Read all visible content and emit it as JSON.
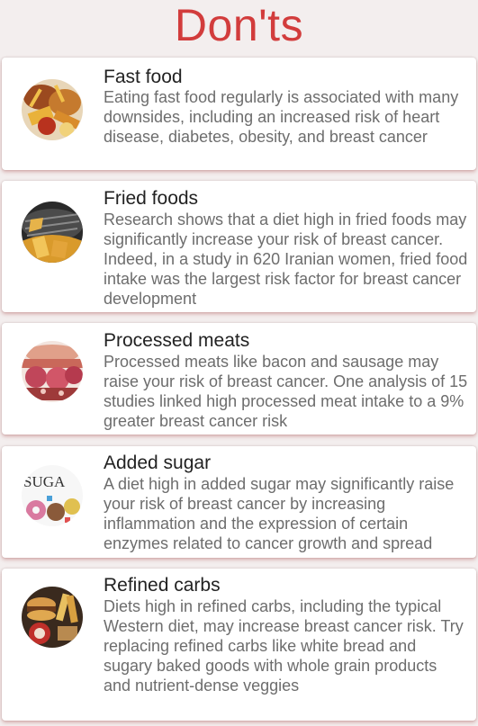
{
  "page": {
    "title": "Don'ts"
  },
  "items": [
    {
      "title": "Fast food",
      "description": "Eating fast food regularly is associated with many downsides, including an increased risk of heart disease, diabetes, obesity, and breast cancer",
      "image_icon": "fast-food-image"
    },
    {
      "title": "Fried foods",
      "description": "Research shows that a diet high in fried foods may significantly increase your risk of breast cancer. Indeed, in a study in 620 Iranian women, fried food intake was the largest risk factor for breast cancer development",
      "image_icon": "fried-foods-image"
    },
    {
      "title": "Processed meats",
      "description": "Processed meats like bacon and sausage may raise your risk of breast cancer. One analysis of 15 studies linked high processed meat intake to a 9% greater breast cancer risk",
      "image_icon": "processed-meats-image"
    },
    {
      "title": "Added sugar",
      "description": "A diet high in added sugar may significantly raise your risk of breast cancer by increasing inflammation and the expression of certain enzymes related to cancer growth and spread",
      "image_icon": "added-sugar-image",
      "image_text": "SUGA"
    },
    {
      "title": "Refined carbs",
      "description": "Diets high in refined carbs, including the typical Western diet, may increase breast cancer risk. Try replacing refined carbs like white bread and sugary baked goods with whole grain products and nutrient-dense veggies",
      "image_icon": "refined-carbs-image"
    }
  ],
  "colors": {
    "title": "#d23c3c",
    "background": "#f3eeee",
    "card": "#ffffff",
    "item_title": "#222222",
    "item_text": "#6d6d6d"
  }
}
